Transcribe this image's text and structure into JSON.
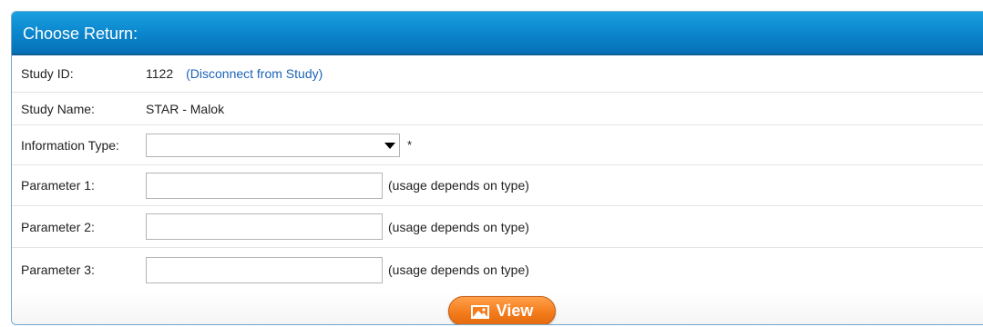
{
  "panel": {
    "title": "Choose Return:"
  },
  "rows": {
    "study_id": {
      "label": "Study ID:",
      "value": "1122",
      "link": "(Disconnect from Study)"
    },
    "study_name": {
      "label": "Study Name:",
      "value": "STAR - Malok"
    },
    "information_type": {
      "label": "Information Type:",
      "selected": "",
      "required": "*"
    },
    "param1": {
      "label": "Parameter 1:",
      "value": "",
      "hint": "(usage depends on type)"
    },
    "param2": {
      "label": "Parameter 2:",
      "value": "",
      "hint": "(usage depends on type)"
    },
    "param3": {
      "label": "Parameter 3:",
      "value": "",
      "hint": "(usage depends on type)"
    }
  },
  "actions": {
    "view_label": "View",
    "view_icon": "image-icon"
  },
  "colors": {
    "header": "#0a84cc",
    "link": "#1b63b8",
    "button": "#f47c1c"
  }
}
